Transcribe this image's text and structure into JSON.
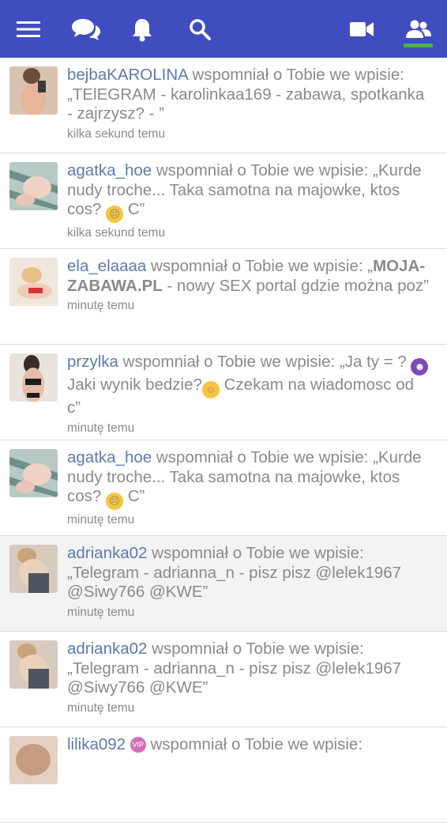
{
  "nav": {
    "icons": [
      "menu-icon",
      "chat-icon",
      "bell-icon",
      "search-icon",
      "video-icon",
      "users-icon"
    ],
    "accent": "#3f4dbf",
    "active_indicator": "#4caf50"
  },
  "connector": "wspomniał o Tobie we wpisie:",
  "notifications": [
    {
      "user": "bejbaKAROLINA",
      "text": "„TElEGRAM - karolinkaa169 - zabawa, spotkanka - zajrzysz? - ”",
      "time": "kilka sekund temu"
    },
    {
      "user": "agatka_hoe",
      "text_before": "„Kurde nudy troche... Taka samotna na majowke, ktos cos?",
      "emoji": "sad-face",
      "text_after": "C”",
      "time": "kilka sekund temu"
    },
    {
      "user": "ela_elaaaa",
      "brand": "MOJA-ZABAWA.PL",
      "text_before": "„",
      "text_after": " - nowy SEX portal gdzie można poz”",
      "time": "minutę temu"
    },
    {
      "user": "przylka",
      "text_before": "„Ja ty = ?",
      "emoji1": "devil-face",
      "text_mid": "Jaki wynik bedzie?",
      "emoji2": "yum-face",
      "text_after": "Czekam na wiadomosc od c”",
      "time": "minutę temu"
    },
    {
      "user": "agatka_hoe",
      "text_before": "„Kurde nudy troche... Taka samotna na majowke, ktos cos?",
      "emoji": "sad-face",
      "text_after": "C”",
      "time": "minutę temu"
    },
    {
      "user": "adrianka02",
      "text": "„Telegram - adrianna_n - pisz pisz @lelek1967 @Siwy766 @KWE”",
      "time": "minutę temu"
    },
    {
      "user": "adrianka02",
      "text": "„Telegram - adrianna_n - pisz pisz @lelek1967 @Siwy766 @KWE”",
      "time": "minutę temu"
    },
    {
      "user": "lilika092",
      "badge": "VIP"
    }
  ]
}
